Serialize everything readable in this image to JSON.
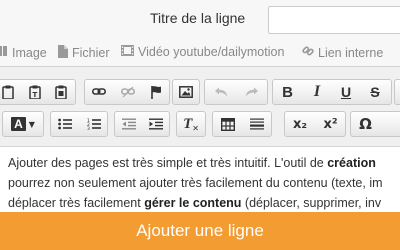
{
  "form": {
    "title_label": "Titre de la ligne",
    "title_value": ""
  },
  "media": {
    "image": "Image",
    "file": "Fichier",
    "video": "Vidéo youtube/dailymotion",
    "link": "Lien interne"
  },
  "toolbar": {
    "bold": "B",
    "italic": "I",
    "underline": "U",
    "strike": "S",
    "text_color": "A",
    "clear_format": "T",
    "subscript": "x₂",
    "superscript": "x²",
    "special_char": "Ω"
  },
  "content": {
    "line1_a": "Ajouter des pages est très simple et très intuitif. L'outil de ",
    "line1_b": "création",
    "line2": "pourrez non seulement ajouter très facilement du contenu (texte, im",
    "line3_a": "déplacer très facilement ",
    "line3_b": "gérer le contenu",
    "line3_c": " (déplacer, supprimer, inv"
  },
  "submit": {
    "label": "Ajouter une ligne"
  },
  "colors": {
    "accent": "#f39c32"
  }
}
